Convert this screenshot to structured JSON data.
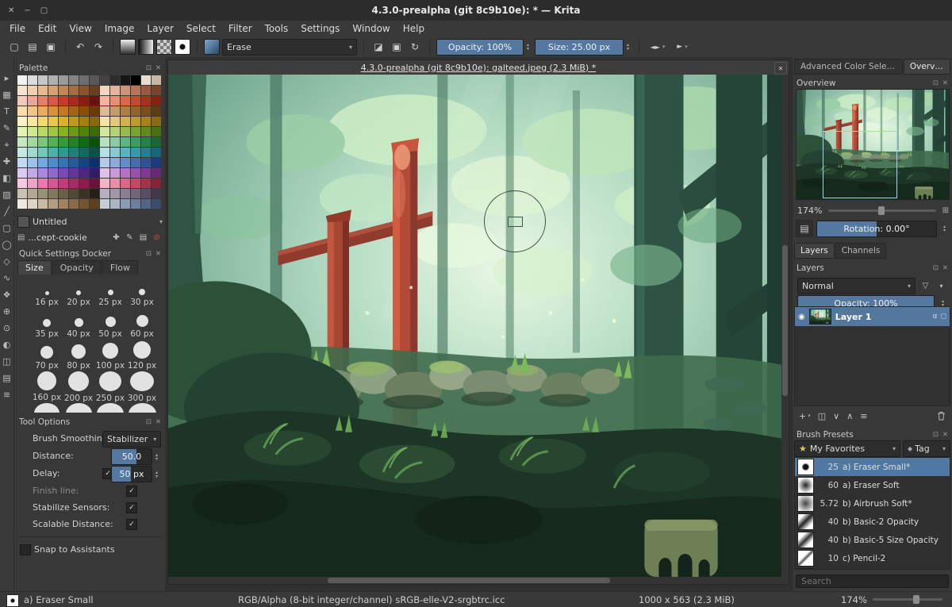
{
  "window": {
    "title": "4.3.0-prealpha (git 8c9b10e): * — Krita"
  },
  "icons": {
    "close": "✕",
    "minimize": "−",
    "maximize": "▢",
    "undo": "↶",
    "redo": "↷",
    "new_doc": "▢",
    "open": "▤",
    "save": "▣",
    "caret": "▾",
    "spin_up": "▴",
    "spin_down": "▾",
    "eraser": "◪",
    "alpha_lock": "▣",
    "reload": "↻",
    "mirror_h": "◄►",
    "wrap": "►",
    "float": "⊡",
    "dock_close": "✕",
    "plus": "✚",
    "edit": "✎",
    "folder": "▤",
    "block": "⊘",
    "check": "✓",
    "star": "★",
    "tag": "◆",
    "eye": "◉",
    "funnel": "▽",
    "add": "+",
    "duplicate": "◫",
    "down": "∨",
    "up": "∧",
    "props": "≡",
    "fit": "⊞",
    "canvas_mode": "▤",
    "alpha": "α",
    "lock": "◻"
  },
  "menu": {
    "items": [
      "File",
      "Edit",
      "View",
      "Image",
      "Layer",
      "Select",
      "Filter",
      "Tools",
      "Settings",
      "Window",
      "Help"
    ]
  },
  "toolbar": {
    "erase": "Erase",
    "opacity": "Opacity: 100%",
    "size": "Size: 25.00 px"
  },
  "toolbox": {
    "tools": [
      {
        "name": "select-tool-icon",
        "glyph": "▸"
      },
      {
        "name": "transform-tool-icon",
        "glyph": "▦"
      },
      {
        "name": "text-tool-icon",
        "glyph": "T"
      },
      {
        "name": "edit-shapes-tool-icon",
        "glyph": "✎"
      },
      {
        "name": "crop-tool-icon",
        "glyph": "⌖"
      },
      {
        "name": "move-tool-icon",
        "glyph": "✚"
      },
      {
        "name": "fill-tool-icon",
        "glyph": "◧"
      },
      {
        "name": "gradient-tool-icon",
        "glyph": "▨"
      },
      {
        "name": "line-tool-icon",
        "glyph": "╱"
      },
      {
        "name": "rectangle-tool-icon",
        "glyph": "▢"
      },
      {
        "name": "ellipse-tool-icon",
        "glyph": "◯"
      },
      {
        "name": "polygon-tool-icon",
        "glyph": "◇"
      },
      {
        "name": "polyline-tool-icon",
        "glyph": "∿"
      },
      {
        "name": "multibrush-tool-icon",
        "glyph": "❖"
      },
      {
        "name": "assistants-tool-icon",
        "glyph": "⊕"
      },
      {
        "name": "color-sampler-tool-icon",
        "glyph": "⊙"
      },
      {
        "name": "contiguous-select-tool-icon",
        "glyph": "◐"
      },
      {
        "name": "outline-select-tool-icon",
        "glyph": "◫"
      },
      {
        "name": "pan-tool-icon",
        "glyph": "▤"
      },
      {
        "name": "zoom-tool-icon",
        "glyph": "≋"
      }
    ]
  },
  "palette": {
    "title": "Palette",
    "selected_name": "Untitled",
    "list_name": "...cept-cookie",
    "colors": [
      "#f2f2f2",
      "#dcdcdc",
      "#c6c6c6",
      "#b0b0b0",
      "#9a9a9a",
      "#848484",
      "#6e6e6e",
      "#585858",
      "#424242",
      "#2c2c2c",
      "#161616",
      "#000000",
      "#e8ddcf",
      "#c9b9a2",
      "#f6e3cd",
      "#f0cfae",
      "#e8b98e",
      "#d9a071",
      "#c48655",
      "#a96c3e",
      "#8a542c",
      "#6b3e1d",
      "#f3d6c2",
      "#e3b49a",
      "#cf9377",
      "#b67458",
      "#985a40",
      "#7a432c",
      "#f6c9bd",
      "#f0a493",
      "#e67e6a",
      "#d85a45",
      "#c43b2a",
      "#a82b1c",
      "#8a1d10",
      "#6b1208",
      "#f5b4a0",
      "#ea8d71",
      "#da674a",
      "#c24a2e",
      "#a43418",
      "#85240c",
      "#f8dcae",
      "#f2c586",
      "#e9ab5e",
      "#da9138",
      "#c57820",
      "#a86212",
      "#894e08",
      "#6a3c02",
      "#dcbb92",
      "#c49c6a",
      "#aa7f46",
      "#91662e",
      "#77501e",
      "#5f3d12",
      "#faf2c4",
      "#f8e89c",
      "#f2d96e",
      "#e9c843",
      "#dab226",
      "#c49a13",
      "#a68108",
      "#876a02",
      "#f2e2a4",
      "#e2ca77",
      "#d0b250",
      "#bc9a30",
      "#a5831c",
      "#886c10",
      "#e4f2b2",
      "#cfe98c",
      "#b7da64",
      "#9dc83e",
      "#83b324",
      "#6a9b13",
      "#528208",
      "#3d6a02",
      "#d4e8a2",
      "#b5d274",
      "#97bb4e",
      "#7aa32f",
      "#61891c",
      "#497010",
      "#c6e9c4",
      "#a0da9d",
      "#79c876",
      "#53b350",
      "#359b33",
      "#238322",
      "#146a14",
      "#0a520a",
      "#b6e2c2",
      "#8acca4",
      "#5eb383",
      "#3e9b62",
      "#2a8148",
      "#1a6832",
      "#c4e9e1",
      "#9cdad2",
      "#70c8bf",
      "#48b3a9",
      "#2c9b91",
      "#1b837a",
      "#0f6a62",
      "#07524a",
      "#b4e1e8",
      "#86cad8",
      "#58b2c2",
      "#3899aa",
      "#248091",
      "#146877",
      "#c4d9f2",
      "#9cc2e9",
      "#74a9e0",
      "#4c8ed2",
      "#3274b9",
      "#215ca0",
      "#134487",
      "#0a306e",
      "#b4cae8",
      "#8cabd8",
      "#648cc6",
      "#466cb0",
      "#2f5298",
      "#1e3a80",
      "#d9cbf2",
      "#c2aae9",
      "#a989dd",
      "#9168cd",
      "#7949b5",
      "#61379c",
      "#4a2783",
      "#341a6a",
      "#e0c2e9",
      "#c99ad8",
      "#b173c2",
      "#9852a9",
      "#803a91",
      "#682878",
      "#f6c9e0",
      "#f0a2c8",
      "#e67bae",
      "#d85694",
      "#c43b7c",
      "#a82b64",
      "#8a1d4e",
      "#6b1238",
      "#f5b4c6",
      "#ea8da6",
      "#da6786",
      "#c24a66",
      "#a4344c",
      "#852436",
      "#cac2b0",
      "#b2a890",
      "#9a9076",
      "#82785e",
      "#6a6048",
      "#524834",
      "#3a3222",
      "#242014",
      "#b8b0c2",
      "#a098aa",
      "#888092",
      "#70687a",
      "#585062",
      "#42384c",
      "#efe8de",
      "#dfd4c2",
      "#cbb9a0",
      "#b69c80",
      "#a08262",
      "#8a6a48",
      "#745432",
      "#5e4020",
      "#c6ced8",
      "#a8b6c6",
      "#8a9cb2",
      "#6c809c",
      "#526684",
      "#3a4e6c"
    ]
  },
  "quick": {
    "title": "Quick Settings Docker",
    "tabs": [
      "Size",
      "Opacity",
      "Flow"
    ],
    "sizes": [
      {
        "label": "16 px",
        "d": 5
      },
      {
        "label": "20 px",
        "d": 6
      },
      {
        "label": "25 px",
        "d": 7
      },
      {
        "label": "30 px",
        "d": 8
      },
      {
        "label": "35 px",
        "d": 10
      },
      {
        "label": "40 px",
        "d": 11
      },
      {
        "label": "50 px",
        "d": 13
      },
      {
        "label": "60 px",
        "d": 15
      },
      {
        "label": "70 px",
        "d": 16
      },
      {
        "label": "80 px",
        "d": 18
      },
      {
        "label": "100 px",
        "d": 20
      },
      {
        "label": "120 px",
        "d": 22
      },
      {
        "label": "160 px",
        "d": 24
      },
      {
        "label": "200 px",
        "d": 26
      },
      {
        "label": "250 px",
        "d": 28
      },
      {
        "label": "300 px",
        "d": 30
      },
      {
        "label": "",
        "d": 32
      },
      {
        "label": "",
        "d": 33
      },
      {
        "label": "",
        "d": 34
      },
      {
        "label": "",
        "d": 35
      }
    ]
  },
  "tool_options": {
    "title": "Tool Options",
    "brush_smoothing": "Brush Smoothing:",
    "smoothing_mode": "Stabilizer",
    "distance_label": "Distance:",
    "distance_value": "50.0",
    "delay_label": "Delay:",
    "delay_value": "50 px",
    "finish_line": "Finish line:",
    "stabilize_sensors": "Stabilize Sensors:",
    "scalable_distance": "Scalable Distance:",
    "snap_assistants": "Snap to Assistants"
  },
  "canvas": {
    "title": "4.3.0-prealpha (git 8c9b10e): galteed.jpeg (2.3 MiB) *"
  },
  "right": {
    "tab_advanced": "Advanced Color Selec...",
    "tab_overview": "Overvi...",
    "overview_title": "Overview",
    "zoom": "174%",
    "rotation": "Rotation: 0.00°",
    "tab_layers": "Layers",
    "tab_channels": "Channels",
    "layers_title": "Layers",
    "blend_mode": "Normal",
    "layer_opacity": "Opacity: 100%",
    "layer_name": "Layer 1",
    "presets_title": "Brush Presets",
    "favorites": "My Favorites",
    "tag": "Tag",
    "presets": [
      {
        "size": "25",
        "name": "a) Eraser Small*",
        "bg": "#4f79a3"
      },
      {
        "size": "60",
        "name": "a) Eraser Soft",
        "bg": "transparent"
      },
      {
        "size": "5.72",
        "name": "b) Airbrush Soft*",
        "bg": "transparent"
      },
      {
        "size": "40",
        "name": "b) Basic-2 Opacity",
        "bg": "transparent"
      },
      {
        "size": "40",
        "name": "b) Basic-5 Size Opacity",
        "bg": "transparent"
      },
      {
        "size": "10",
        "name": "c) Pencil-2",
        "bg": "transparent"
      },
      {
        "size": "",
        "name": "",
        "bg": "transparent"
      }
    ],
    "search_placeholder": "Search"
  },
  "statusbar": {
    "preset": "a) Eraser Small",
    "profile": "RGB/Alpha (8-bit integer/channel)  sRGB-elle-V2-srgbtrc.icc",
    "dimensions": "1000 x 563 (2.3 MiB)",
    "zoom": "174%"
  },
  "colors": {
    "accent": "#54789f",
    "selection": "#54779d"
  }
}
